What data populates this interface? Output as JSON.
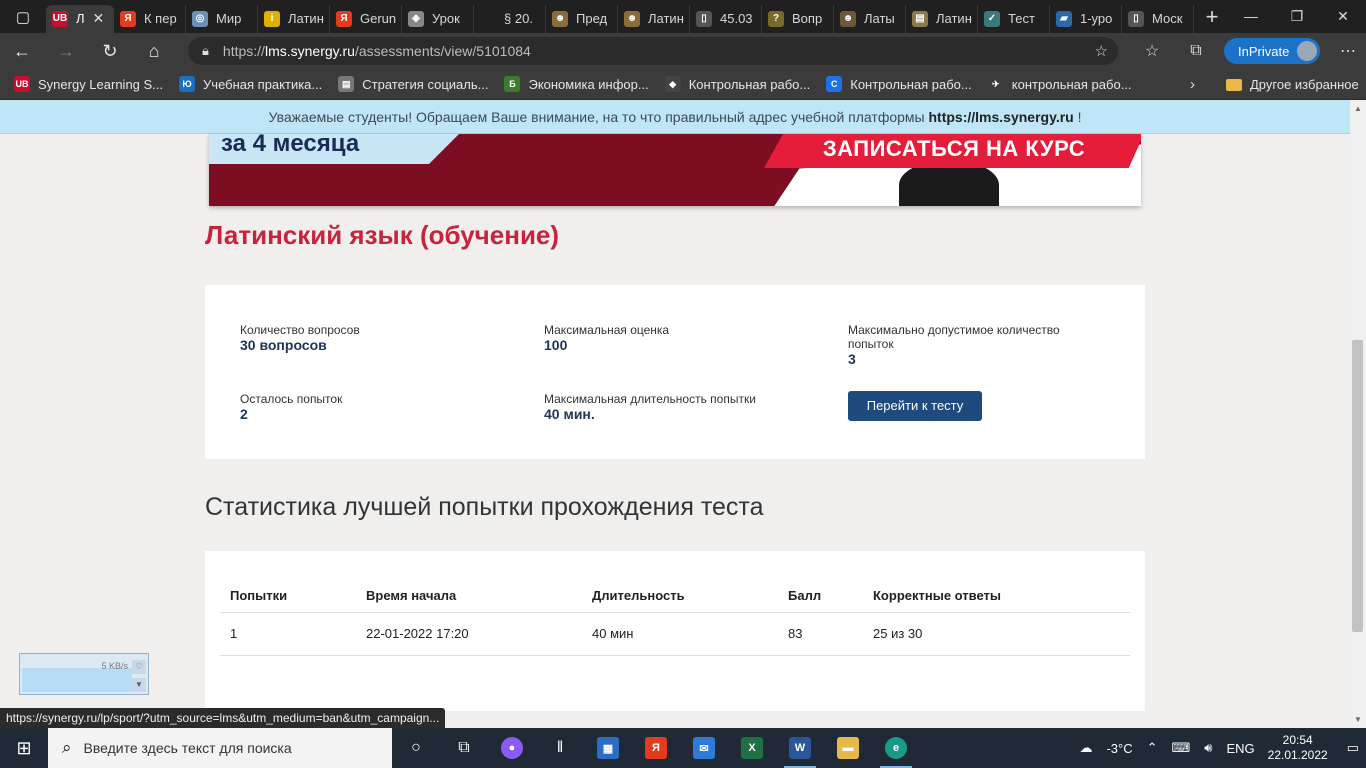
{
  "browser": {
    "tabs": [
      {
        "label": "Л",
        "fav": "UB",
        "color": "#c8102e",
        "active": true
      },
      {
        "label": "К пер",
        "fav": "Я",
        "color": "#e23b1d"
      },
      {
        "label": "Мир",
        "fav": "◎",
        "color": "#6c8fb8"
      },
      {
        "label": "Латин",
        "fav": "i",
        "color": "#e0b000"
      },
      {
        "label": "Gerun",
        "fav": "Я",
        "color": "#e23b1d"
      },
      {
        "label": "Урок",
        "fav": "◈",
        "color": "#888888"
      },
      {
        "label": "§ 20.",
        "fav": "",
        "color": "#202020"
      },
      {
        "label": "Пред",
        "fav": "☻",
        "color": "#8a6d3b"
      },
      {
        "label": "Латин",
        "fav": "☻",
        "color": "#8a6d3b"
      },
      {
        "label": "45.03",
        "fav": "▯",
        "color": "#555555"
      },
      {
        "label": "Вопр",
        "fav": "?",
        "color": "#7a6a2a"
      },
      {
        "label": "Латы",
        "fav": "☻",
        "color": "#6b5a3a"
      },
      {
        "label": "Латин",
        "fav": "▤",
        "color": "#8a7a4a"
      },
      {
        "label": "Тест",
        "fav": "✓",
        "color": "#3a7a7a"
      },
      {
        "label": "1-уро",
        "fav": "▰",
        "color": "#2a6aaa"
      },
      {
        "label": "Моск",
        "fav": "▯",
        "color": "#555555"
      }
    ],
    "url_scheme": "https://",
    "url_host": "lms.synergy.ru",
    "url_path": "/assessments/view/5101084",
    "inprivate_label": "InPrivate",
    "bookmarks": [
      {
        "label": "Synergy Learning S...",
        "fav": "UB",
        "color": "#c8102e"
      },
      {
        "label": "Учебная практика...",
        "fav": "Ю",
        "color": "#1a6fbf"
      },
      {
        "label": "Стратегия социаль...",
        "fav": "▤",
        "color": "#777777"
      },
      {
        "label": "Экономика инфор...",
        "fav": "Б",
        "color": "#3a7d2a"
      },
      {
        "label": "Контрольная рабо...",
        "fav": "◆",
        "color": "#444444"
      },
      {
        "label": "Контрольная рабо...",
        "fav": "C",
        "color": "#1a73e8"
      },
      {
        "label": "контрольная рабо...",
        "fav": "✈",
        "color": "#3b3b3b"
      }
    ],
    "other_bookmarks_label": "Другое избранное"
  },
  "page": {
    "notice_text": "Уважаемые студенты! Обращаем Ваше внимание, на то что правильный адрес учебной платформы ",
    "notice_link": "https://lms.synergy.ru",
    "notice_end": " !",
    "banner": {
      "promo_text": "за 4 месяца",
      "cta_text": "ЗАПИСАТЬСЯ НА КУРС"
    },
    "course_title": "Латинский язык (обучение)",
    "info": {
      "questions_label": "Количество вопросов",
      "questions_value": "30 вопросов",
      "max_score_label": "Максимальная оценка",
      "max_score_value": "100",
      "max_attempts_label": "Максимально допустимое количество попыток",
      "max_attempts_value": "3",
      "attempts_left_label": "Осталось попыток",
      "attempts_left_value": "2",
      "max_duration_label": "Максимальная длительность попытки",
      "max_duration_value": "40 мин.",
      "go_button": "Перейти к тесту"
    },
    "stats_title": "Статистика лучшей попытки прохождения теста",
    "stats_table": {
      "headers": [
        "Попытки",
        "Время начала",
        "Длительность",
        "Балл",
        "Корректные ответы"
      ],
      "rows": [
        [
          "1",
          "22-01-2022 17:20",
          "40 мин",
          "83",
          "25 из 30"
        ]
      ]
    },
    "net_rate": "5 KB/s",
    "status_url": "https://synergy.ru/lp/sport/?utm_source=lms&utm_medium=ban&utm_campaign..."
  },
  "taskbar": {
    "search_placeholder": "Введите здесь текст для поиска",
    "weather": "-3°C",
    "language": "ENG",
    "time": "20:54",
    "date": "22.01.2022"
  }
}
